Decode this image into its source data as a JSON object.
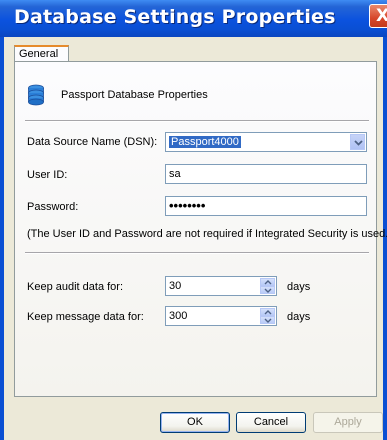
{
  "window": {
    "title": "Database Settings Properties",
    "close_glyph": "X"
  },
  "tabs": [
    {
      "label": "General",
      "selected": true
    }
  ],
  "header": {
    "icon": "database-icon",
    "label": "Passport Database Properties"
  },
  "form": {
    "dsn": {
      "label": "Data Source Name (DSN):",
      "value": "Passport4000"
    },
    "user_id": {
      "label": "User ID:",
      "value": "sa"
    },
    "password": {
      "label": "Password:",
      "value": "••••••••"
    },
    "note": "(The User ID and Password are not required if Integrated Security is used.)",
    "audit": {
      "label": "Keep audit data for:",
      "value": "30",
      "unit": "days"
    },
    "message": {
      "label": "Keep message data for:",
      "value": "300",
      "unit": "days"
    }
  },
  "buttons": {
    "ok": "OK",
    "cancel": "Cancel",
    "apply": "Apply"
  },
  "colors": {
    "titlebar": "#0a4fd3",
    "selection": "#316ac5",
    "tab_highlight": "#e68b2c"
  }
}
